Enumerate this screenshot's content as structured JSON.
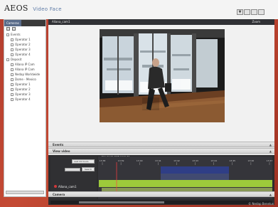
{
  "app": {
    "brand": "AEOS",
    "product": "Video Face"
  },
  "window_controls": {
    "select_label": "▼"
  },
  "left_panel": {
    "tab_active": "Cameras",
    "tab_other": "",
    "groups": [
      {
        "label": "Events",
        "items": [
          "Operator 1",
          "Operator 2",
          "Operator 3",
          "Operator 4"
        ]
      },
      {
        "label": "Deposit",
        "items": [
          "Allana IP Cam",
          "Allana IP Cam",
          "Nedap Worldwide",
          "Dome - Mexico",
          "Operator 1",
          "Operator 2",
          "Operator 3",
          "Operator 4"
        ]
      }
    ]
  },
  "camera": {
    "title": "Allana_cam1",
    "zoom": "Zoom"
  },
  "sections": {
    "events": "Events",
    "view_video": "View video",
    "camera": "Camera"
  },
  "timeline": {
    "select_value": "Last 24 hours",
    "button": "Search",
    "camera_label": "Allana_cam1",
    "date_label": "Mon 02-06-2008 13:41:37",
    "ticks": [
      "13:38",
      "13:39",
      "13:40",
      "13:41",
      "13:42",
      "13:43",
      "13:44",
      "13:45",
      "13:46",
      "13:47"
    ]
  },
  "watermark": "© Nedap Benelux",
  "colors": {
    "frame": "#b33d2e",
    "green": "#9dca3b",
    "blue_band": "#2f3e86"
  }
}
